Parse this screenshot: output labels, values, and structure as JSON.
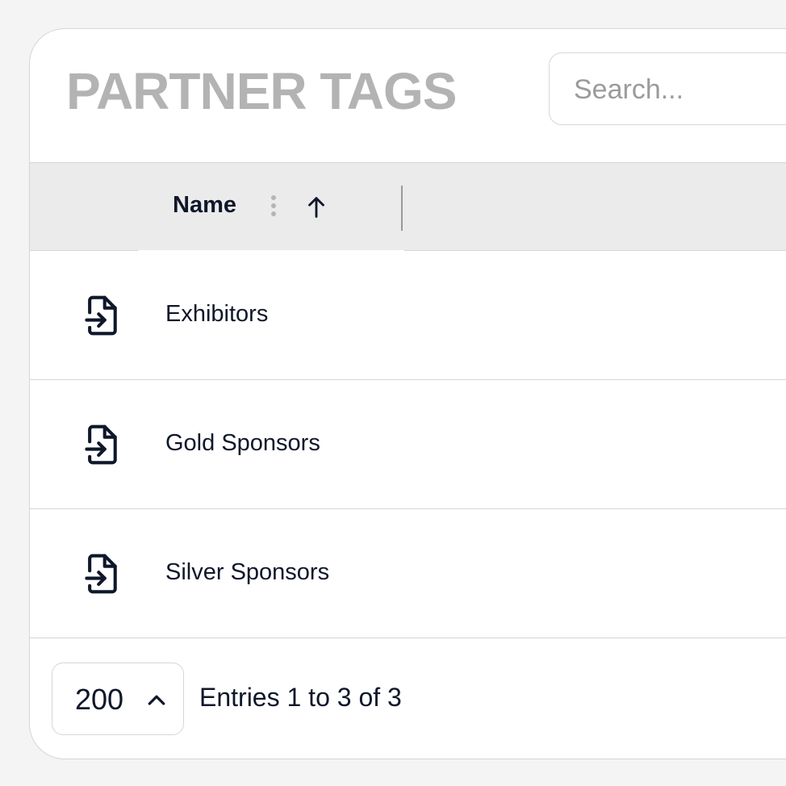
{
  "header": {
    "title": "PARTNER TAGS",
    "search_placeholder": "Search...",
    "search_value": ""
  },
  "table": {
    "columns": [
      {
        "label": "Name",
        "sort": "ascending"
      }
    ],
    "rows": [
      {
        "name": "Exhibitors",
        "icon": "file-import-icon"
      },
      {
        "name": "Gold Sponsors",
        "icon": "file-import-icon"
      },
      {
        "name": "Silver Sponsors",
        "icon": "file-import-icon"
      }
    ]
  },
  "footer": {
    "page_size": "200",
    "entries_text": "Entries 1 to 3 of 3"
  },
  "colors": {
    "title": "#b3b3b3",
    "header_bg": "#ebebeb",
    "border": "#d6d6d6",
    "text": "#0f172a",
    "background": "#f4f4f4"
  }
}
